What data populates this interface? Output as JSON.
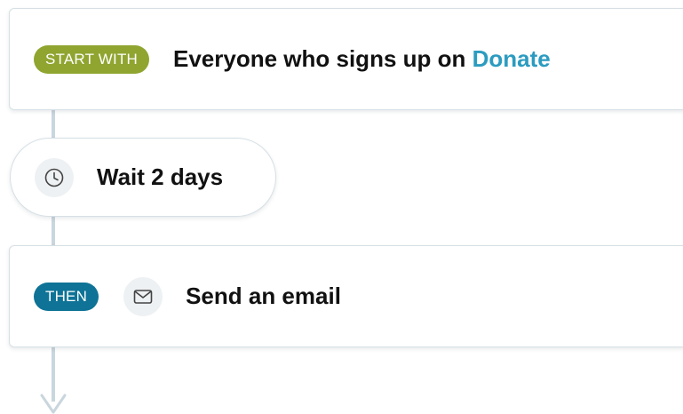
{
  "trigger": {
    "badge": "START WITH",
    "title_prefix": "Everyone who signs up on",
    "title_link": "Donate"
  },
  "wait": {
    "icon": "clock-icon",
    "label": "Wait 2 days"
  },
  "action": {
    "badge": "THEN",
    "icon": "envelope-icon",
    "label": "Send an email"
  },
  "colors": {
    "start_badge": "#8fa530",
    "then_badge": "#0e7396",
    "link": "#2c9bc0",
    "connector": "#c9d6dd"
  }
}
